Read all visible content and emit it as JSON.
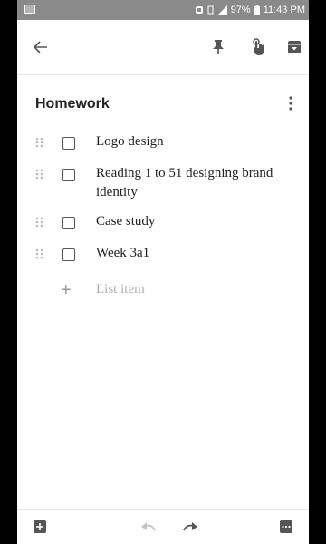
{
  "status_bar": {
    "battery": "97%",
    "time": "11:43 PM"
  },
  "toolbar": {
    "back_icon": "arrow-left-icon",
    "pin_icon": "pin-icon",
    "reminder_icon": "reminder-hand-icon",
    "archive_icon": "archive-icon"
  },
  "note": {
    "title": "Homework",
    "items": [
      {
        "label": "Logo design",
        "checked": false
      },
      {
        "label": "Reading 1 to 51 designing brand identity",
        "checked": false
      },
      {
        "label": "Case study",
        "checked": false
      },
      {
        "label": "Week 3a1",
        "checked": false
      }
    ],
    "add_item_placeholder": "List item"
  },
  "bottom_bar": {
    "add_icon": "add-box-icon",
    "undo_icon": "undo-icon",
    "redo_icon": "redo-icon",
    "more_icon": "more-horizontal-icon"
  },
  "colors": {
    "status_bar_bg": "#8a8a8a",
    "icon_gray": "#555555",
    "text_dark": "#222222",
    "placeholder": "#b0b0b0"
  }
}
